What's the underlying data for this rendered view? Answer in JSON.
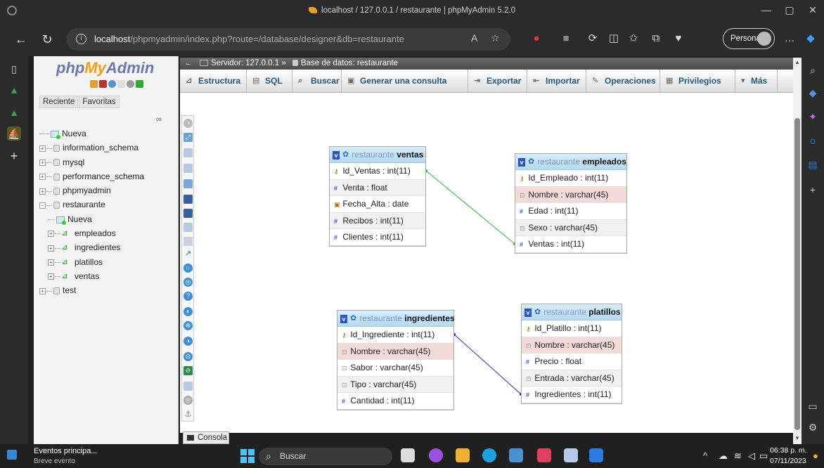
{
  "window": {
    "title": "localhost / 127.0.0.1 / restaurante | phpMyAdmin 5.2.0"
  },
  "browser": {
    "url_host": "localhost",
    "url_path": "/phpmyadmin/index.php?route=/database/designer&db=restaurante",
    "profile_label": "Personal"
  },
  "pma_nav": {
    "logo_php": "php",
    "logo_my": "My",
    "logo_admin": "Admin",
    "tab_recent": "Reciente",
    "tab_favorites": "Favoritas",
    "tree": [
      {
        "label": "Nueva",
        "kind": "new",
        "level": 0
      },
      {
        "label": "information_schema",
        "kind": "db",
        "level": 0
      },
      {
        "label": "mysql",
        "kind": "db",
        "level": 0
      },
      {
        "label": "performance_schema",
        "kind": "db",
        "level": 0
      },
      {
        "label": "phpmyadmin",
        "kind": "db",
        "level": 0
      },
      {
        "label": "restaurante",
        "kind": "db-open",
        "level": 0
      },
      {
        "label": "Nueva",
        "kind": "new",
        "level": 1
      },
      {
        "label": "empleados",
        "kind": "table",
        "level": 1
      },
      {
        "label": "ingredientes",
        "kind": "table",
        "level": 1
      },
      {
        "label": "platillos",
        "kind": "table",
        "level": 1
      },
      {
        "label": "ventas",
        "kind": "table",
        "level": 1
      },
      {
        "label": "test",
        "kind": "db",
        "level": 0
      }
    ]
  },
  "breadcrumb": {
    "server": "Servidor: 127.0.0.1",
    "separator": "»",
    "database": "Base de datos: restaurante"
  },
  "tabs": [
    {
      "label": "Estructura",
      "icon": "structure-icon"
    },
    {
      "label": "SQL",
      "icon": "sql-icon"
    },
    {
      "label": "Buscar",
      "icon": "search-icon"
    },
    {
      "label": "Generar una consulta",
      "icon": "query-icon"
    },
    {
      "label": "Exportar",
      "icon": "export-icon"
    },
    {
      "label": "Importar",
      "icon": "import-icon"
    },
    {
      "label": "Operaciones",
      "icon": "wrench-icon"
    },
    {
      "label": "Privilegios",
      "icon": "privileges-icon"
    },
    {
      "label": "Más",
      "icon": "caret-down-icon"
    }
  ],
  "designer": {
    "db_name": "restaurante",
    "tables": [
      {
        "id": "ventas",
        "name": "ventas",
        "columns": [
          {
            "text": "Id_Ventas : int(11)",
            "key": "pk"
          },
          {
            "text": "Venta : float",
            "key": "num"
          },
          {
            "text": "Fecha_Alta : date",
            "key": "date"
          },
          {
            "text": "Recibos : int(11)",
            "key": "num"
          },
          {
            "text": "Clientes : int(11)",
            "key": "num"
          }
        ]
      },
      {
        "id": "empleados",
        "name": "empleados",
        "columns": [
          {
            "text": "Id_Empleado : int(11)",
            "key": "pk"
          },
          {
            "text": "Nombre : varchar(45)",
            "key": "str"
          },
          {
            "text": "Edad : int(11)",
            "key": "num"
          },
          {
            "text": "Sexo : varchar(45)",
            "key": "str"
          },
          {
            "text": "Ventas : int(11)",
            "key": "num"
          }
        ]
      },
      {
        "id": "ingredientes",
        "name": "ingredientes",
        "columns": [
          {
            "text": "Id_Ingrediente : int(11)",
            "key": "pk"
          },
          {
            "text": "Nombre : varchar(45)",
            "key": "str"
          },
          {
            "text": "Sabor : varchar(45)",
            "key": "str"
          },
          {
            "text": "Tipo : varchar(45)",
            "key": "str"
          },
          {
            "text": "Cantidad : int(11)",
            "key": "num"
          }
        ]
      },
      {
        "id": "platillos",
        "name": "platillos",
        "columns": [
          {
            "text": "Id_Platillo : int(11)",
            "key": "pk"
          },
          {
            "text": "Nombre : varchar(45)",
            "key": "str"
          },
          {
            "text": "Precio : float",
            "key": "num"
          },
          {
            "text": "Entrada : varchar(45)",
            "key": "str"
          },
          {
            "text": "Ingredientes : int(11)",
            "key": "num"
          }
        ]
      }
    ],
    "relations": [
      {
        "from": "ventas.Id_Ventas",
        "to": "empleados.Ventas",
        "color": "#2fb82f"
      },
      {
        "from": "ingredientes.Id_Ingrediente",
        "to": "platillos.Ingredientes",
        "color": "#2a2ad0"
      }
    ]
  },
  "console_label": "Consola",
  "taskbar": {
    "news_title": "Eventos principa...",
    "news_sub": "Breve evento",
    "search_label": "Buscar",
    "time": "06:38 p. m.",
    "date": "07/11/2023"
  }
}
